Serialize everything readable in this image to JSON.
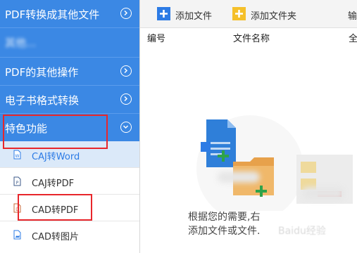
{
  "sidebar": {
    "items": [
      {
        "label": "PDF转换成其他文件"
      },
      {
        "label": "其他..."
      },
      {
        "label": "PDF的其他操作"
      },
      {
        "label": "电子书格式转换"
      },
      {
        "label": "特色功能"
      }
    ],
    "sub_items": [
      {
        "label": "CAJ转Word",
        "icon": "file-word-icon"
      },
      {
        "label": "CAJ转PDF",
        "icon": "file-pdf-icon"
      },
      {
        "label": "CAD转PDF",
        "icon": "file-pdf-icon"
      },
      {
        "label": "CAD转图片",
        "icon": "file-image-icon"
      }
    ]
  },
  "toolbar": {
    "add_file": "添加文件",
    "add_folder": "添加文件夹",
    "output": "输"
  },
  "table": {
    "col_index": "编号",
    "col_name": "文件名称",
    "col_all": "全"
  },
  "empty_state": {
    "line1": "根据您的需要,右",
    "line2": "添加文件或文件."
  },
  "watermark": "Baidu经验",
  "colors": {
    "sidebar_blue": "#3b88e4",
    "highlight_red": "#e8262b",
    "add_green": "#2ea34a",
    "add_blue": "#2c7be5",
    "folder_yellow": "#f5c02a"
  }
}
